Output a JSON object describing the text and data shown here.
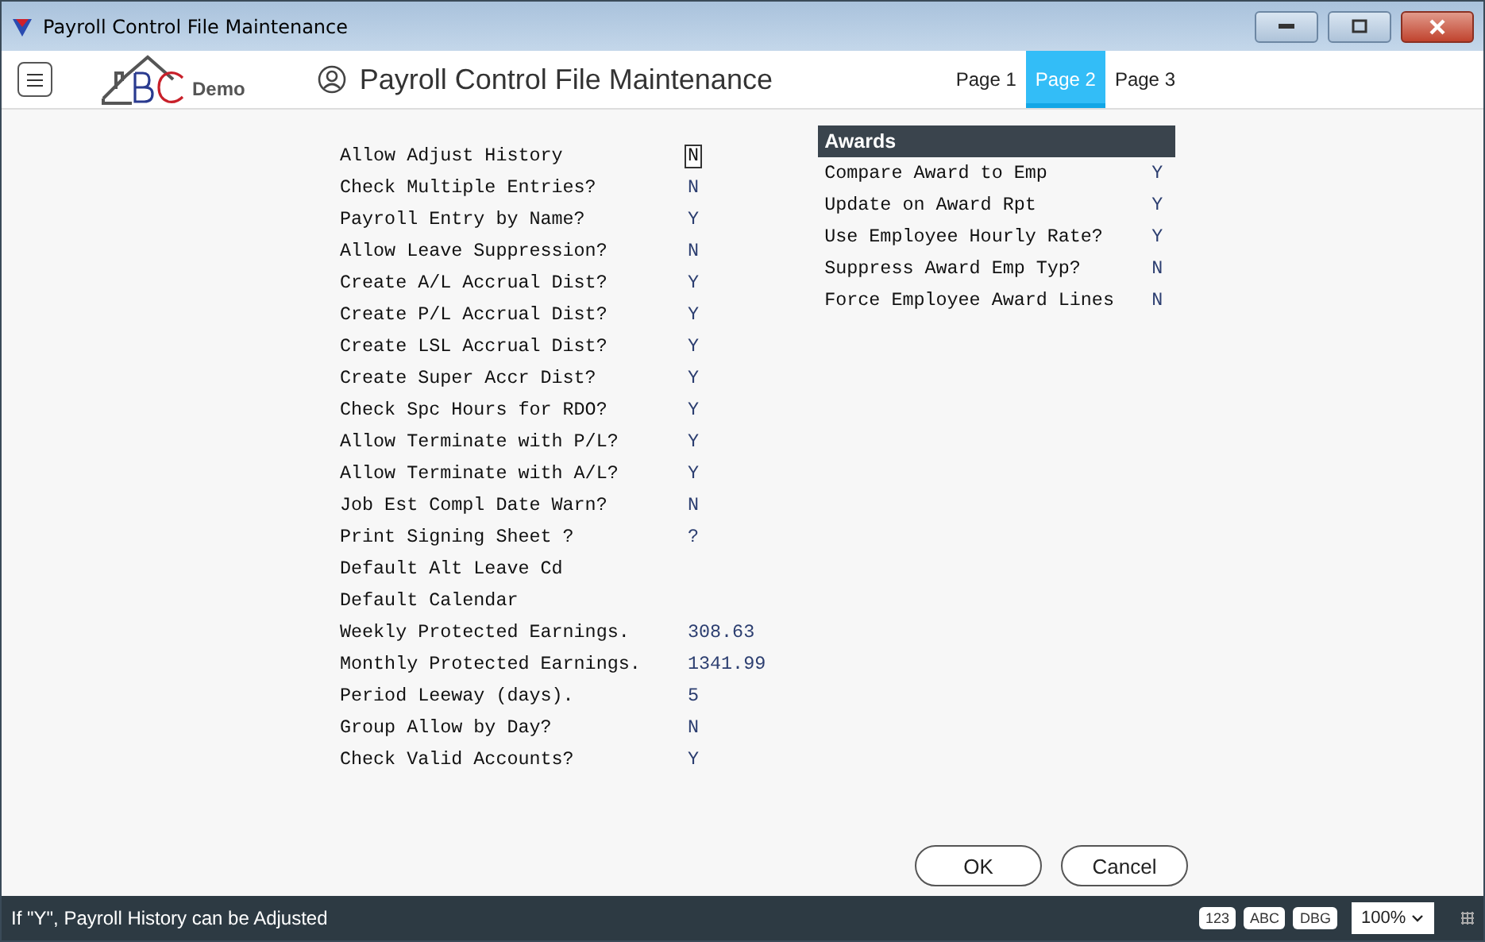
{
  "window": {
    "title": "Payroll Control File Maintenance"
  },
  "header": {
    "logo_text": "Demo",
    "title": "Payroll Control File Maintenance"
  },
  "tabs": [
    {
      "label": "Page 1",
      "selected": false
    },
    {
      "label": "Page 2",
      "selected": true
    },
    {
      "label": "Page 3",
      "selected": false
    }
  ],
  "fields": [
    {
      "label": "Allow Adjust History",
      "value": "N",
      "focused": true
    },
    {
      "label": "Check Multiple Entries?",
      "value": "N",
      "focused": false
    },
    {
      "label": "Payroll Entry by Name?",
      "value": "Y",
      "focused": false
    },
    {
      "label": "Allow Leave Suppression?",
      "value": "N",
      "focused": false
    },
    {
      "label": "Create A/L Accrual Dist?",
      "value": "Y",
      "focused": false
    },
    {
      "label": "Create P/L Accrual Dist?",
      "value": "Y",
      "focused": false
    },
    {
      "label": "Create LSL Accrual Dist?",
      "value": "Y",
      "focused": false
    },
    {
      "label": "Create Super Accr Dist?",
      "value": "Y",
      "focused": false
    },
    {
      "label": "Check Spc Hours for RDO?",
      "value": "Y",
      "focused": false
    },
    {
      "label": "Allow Terminate with P/L?",
      "value": "Y",
      "focused": false
    },
    {
      "label": "Allow Terminate with A/L?",
      "value": "Y",
      "focused": false
    },
    {
      "label": "Job Est Compl Date Warn?",
      "value": "N",
      "focused": false
    },
    {
      "label": "Print Signing Sheet ?",
      "value": "?",
      "focused": false
    },
    {
      "label": "Default Alt Leave Cd"
    },
    {
      "label": "Default Calendar"
    },
    {
      "label": "Weekly Protected Earnings.",
      "value": "308.63",
      "focused": false
    },
    {
      "label": "Monthly Protected Earnings.",
      "value": "1341.99",
      "focused": false
    },
    {
      "label": "Period Leeway (days).",
      "value": "5",
      "focused": false
    },
    {
      "label": "Group Allow by Day?",
      "value": "N",
      "focused": false
    },
    {
      "label": "Check Valid Accounts?",
      "value": "Y",
      "focused": false
    }
  ],
  "awards": {
    "title": "Awards",
    "fields": [
      {
        "label": "Compare Award to Emp",
        "value": "Y"
      },
      {
        "label": "Update on Award Rpt",
        "value": "Y"
      },
      {
        "label": "Use Employee Hourly Rate?",
        "value": "Y"
      },
      {
        "label": "Suppress Award Emp Typ?",
        "value": "N"
      },
      {
        "label": "Force Employee Award Lines",
        "value": "N"
      }
    ]
  },
  "buttons": [
    "OK",
    "Cancel"
  ],
  "status_bar": {
    "message": "If \"Y\", Payroll History can be Adjusted",
    "badges": [
      "123",
      "ABC",
      "DBG"
    ],
    "zoom": "100%"
  }
}
